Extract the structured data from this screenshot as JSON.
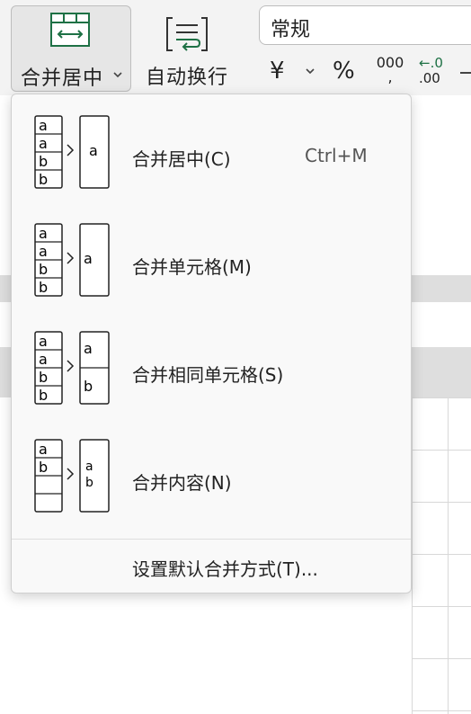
{
  "ribbon": {
    "merge_center": {
      "label": "合并居中",
      "icon": "merge-center-icon"
    },
    "wrap_text": {
      "label": "自动换行",
      "icon": "wrap-text-icon"
    },
    "number_format": {
      "value": "常规"
    },
    "currency_symbol": "¥",
    "percent_symbol": "%",
    "thousands_top": "000",
    "thousands_bottom": ",",
    "decimal_increase_top": "←.0",
    "decimal_increase_bottom": ".00"
  },
  "menu": {
    "items": [
      {
        "label": "合并居中(C)",
        "shortcut": "Ctrl+M",
        "icon": "merge-center-diagram-icon"
      },
      {
        "label": "合并单元格(M)",
        "icon": "merge-cells-diagram-icon"
      },
      {
        "label": "合并相同单元格(S)",
        "icon": "merge-same-cells-diagram-icon"
      },
      {
        "label": "合并内容(N)",
        "icon": "merge-content-diagram-icon"
      }
    ],
    "default_setting": {
      "label": "设置默认合并方式(T)..."
    }
  },
  "diagram_letters": {
    "a": "a",
    "b": "b"
  },
  "colors": {
    "icon_green": "#1e7145",
    "menu_bg": "#f9f9f9",
    "ribbon_bg": "#f3f3f3"
  }
}
